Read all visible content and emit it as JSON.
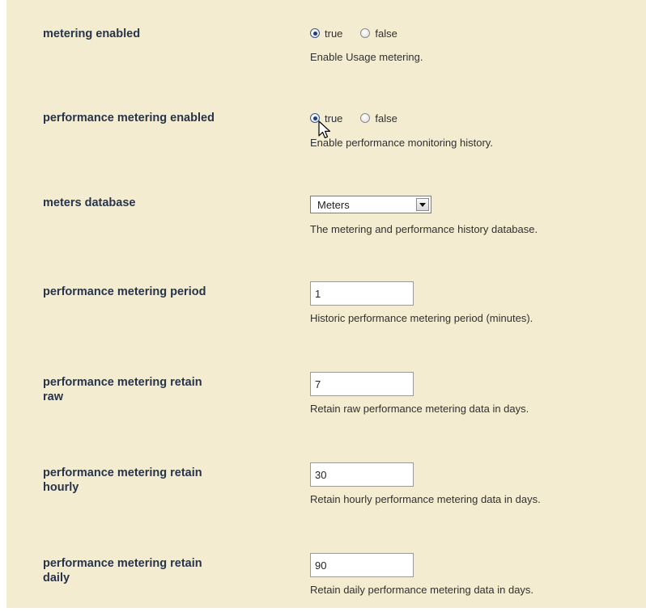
{
  "settings": {
    "metering_enabled": {
      "label": "metering enabled",
      "options": [
        "true",
        "false"
      ],
      "selected": "true",
      "description": "Enable Usage metering."
    },
    "performance_metering_enabled": {
      "label": "performance metering enabled",
      "options": [
        "true",
        "false"
      ],
      "selected": "true",
      "description": "Enable performance monitoring history."
    },
    "meters_database": {
      "label": "meters database",
      "value": "Meters",
      "description": "The metering and performance history database."
    },
    "performance_metering_period": {
      "label": "performance metering period",
      "value": "1",
      "description": "Historic performance metering period (minutes)."
    },
    "retain_raw": {
      "label_line1": "performance metering retain",
      "label_line2": "raw",
      "value": "7",
      "description": "Retain raw performance metering data in days."
    },
    "retain_hourly": {
      "label_line1": "performance metering retain",
      "label_line2": "hourly",
      "value": "30",
      "description": "Retain hourly performance metering data in days."
    },
    "retain_daily": {
      "label_line1": "performance metering retain",
      "label_line2": "daily",
      "value": "90",
      "description": "Retain daily performance metering data in days."
    }
  },
  "icons": {
    "cursor": "mouse-pointer-icon",
    "dropdown": "chevron-down-icon"
  },
  "colors": {
    "panel_background": "#f3ecd0",
    "label_text": "#27344a",
    "radio_selected": "#1b3f7a"
  }
}
